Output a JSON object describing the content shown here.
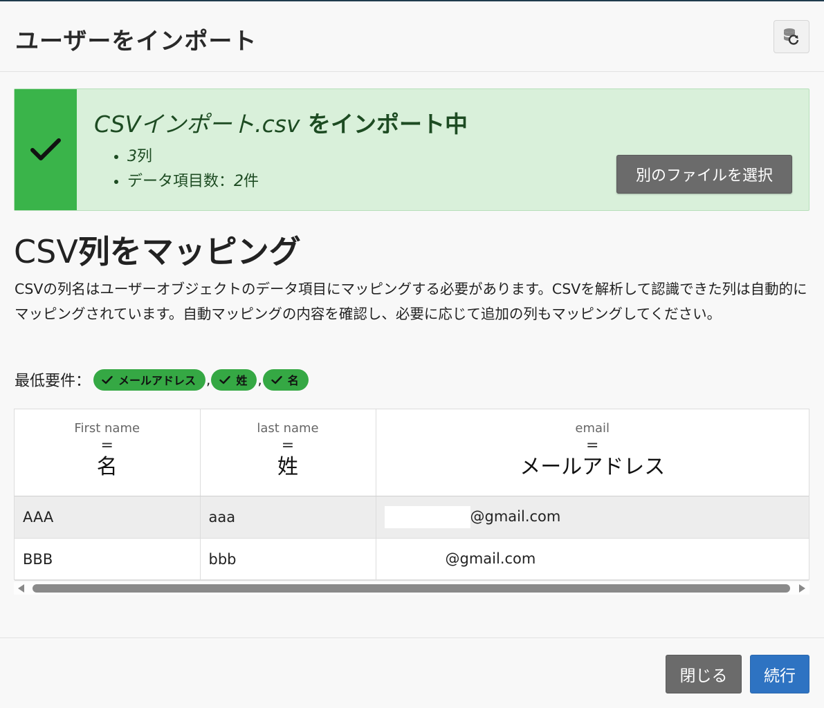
{
  "header": {
    "title": "ユーザーをインポート",
    "refresh_icon": "database-refresh-icon"
  },
  "banner": {
    "filename": "CSVインポート.csv",
    "title_suffix": "をインポート中",
    "stats": [
      {
        "num": "3",
        "label": "列"
      },
      {
        "label": "データ項目数：",
        "num": "2",
        "unit": "件"
      }
    ],
    "alt_file_button": "別のファイルを選択",
    "accent_color": "#3ab44a"
  },
  "mapping": {
    "title_latin": "CSV",
    "title_rest": "列をマッピング",
    "description": "CSVの列名はユーザーオブジェクトのデータ項目にマッピングする必要があります。CSVを解析して認識できた列は自動的にマッピングされています。自動マッピングの内容を確認し、必要に応じて追加の列もマッピングしてください。",
    "requirements_label": "最低要件：",
    "requirements": [
      "メールアドレス",
      "姓",
      "名"
    ],
    "separator": ","
  },
  "table": {
    "eq_symbol": "=",
    "columns": [
      {
        "csv": "First name",
        "mapped": "名"
      },
      {
        "csv": "last name",
        "mapped": "姓"
      },
      {
        "csv": "email",
        "mapped": "メールアドレス"
      }
    ],
    "rows": [
      [
        "AAA",
        "aaa",
        "@gmail.com"
      ],
      [
        "BBB",
        "bbb",
        "@gmail.com"
      ]
    ]
  },
  "footer": {
    "close_label": "閉じる",
    "continue_label": "続行",
    "primary_color": "#2e73c2"
  }
}
